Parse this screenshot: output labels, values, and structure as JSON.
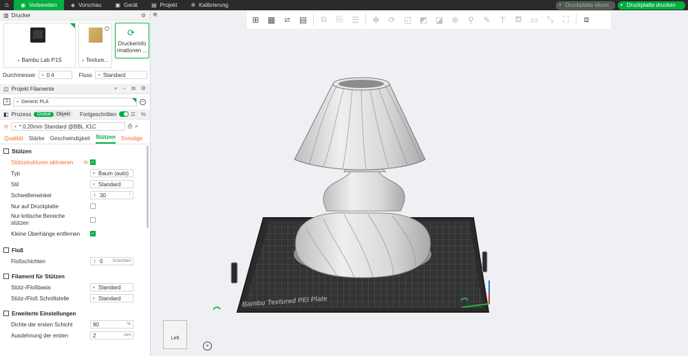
{
  "topbar": {
    "tabs": [
      {
        "label": "Vorbereiten",
        "icon": "prepare-icon"
      },
      {
        "label": "Vorschau",
        "icon": "preview-icon"
      },
      {
        "label": "Gerät",
        "icon": "device-icon"
      },
      {
        "label": "Projekt",
        "icon": "project-icon"
      },
      {
        "label": "Kalibrierung",
        "icon": "calibration-icon"
      }
    ],
    "slice_button": "Druckplatte slicen",
    "print_button": "Druckplatte drucken"
  },
  "printer": {
    "section_title": "Drucker",
    "printer_name": "Bambu Lab P1S",
    "plate_label": "Texture...",
    "printer_info_label_1": "Druckerinfo",
    "printer_info_label_2": "rmationen ...",
    "diameter_label": "Durchmesser",
    "diameter_value": "0.4",
    "flow_label": "Fluss",
    "flow_value": "Standard"
  },
  "filaments": {
    "section_title": "Projekt Filamente",
    "items": [
      {
        "index": "1",
        "name": "Generic PLA"
      }
    ]
  },
  "process": {
    "section_title": "Prozess",
    "toggle_global": "Global",
    "toggle_object": "Objekt",
    "advanced_label": "Fortgeschritten",
    "preset": "* 0.20mm Standard @BBL X1C",
    "tabs": [
      "Qualität",
      "Stärke",
      "Geschwindigkeit",
      "Stützen",
      "Sonstige"
    ],
    "active_tab": "Stützen"
  },
  "settings": {
    "support": {
      "title": "Stützen",
      "enable_label": "Stützstrukturen aktivieren",
      "type_label": "Typ",
      "type_value": "Baum (auto)",
      "style_label": "Stil",
      "style_value": "Standard",
      "threshold_label": "Schwellenwinkel",
      "threshold_value": "30",
      "threshold_unit": "°",
      "buildplate_label": "Nur auf Druckplatte",
      "critical_label_1": "Nur kritische Bereiche",
      "critical_label_2": "stützen",
      "remove_small_label": "Kleine Überhänge entfernen"
    },
    "raft": {
      "title": "Floß",
      "layers_label": "Floßschichten",
      "layers_value": "0",
      "layers_unit": "Schichten"
    },
    "support_filament": {
      "title": "Filament für Stützen",
      "base_label": "Stütz-/Floßbasis",
      "base_value": "Standard",
      "interface_label": "Stütz-/Floß Schnittstelle",
      "interface_value": "Standard"
    },
    "advanced": {
      "title": "Erweiterte Einstellungen",
      "density_label": "Dichte der ersten Schicht",
      "density_value": "90",
      "density_unit": "%",
      "expansion_label": "Ausdehnung der ersten",
      "expansion_value": "2",
      "expansion_unit": "mm"
    }
  },
  "viewport": {
    "plate_label": "Bambu Textured PEI Plate",
    "navcube_label": "Left"
  },
  "colors": {
    "accent": "#00ae42",
    "orange": "#f26d21",
    "topbar": "#2b2b2b"
  }
}
